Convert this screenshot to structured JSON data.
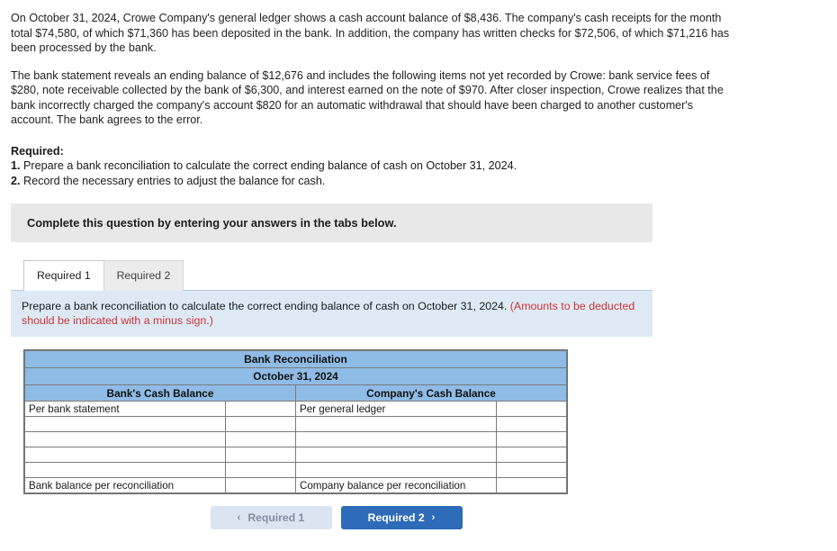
{
  "problem": {
    "paragraph1": "On October 31, 2024, Crowe Company's general ledger shows a cash account balance of $8,436. The company's cash receipts for the month total $74,580, of which $71,360 has been deposited in the bank. In addition, the company has written checks for $72,506, of which $71,216 has been processed by the bank.",
    "paragraph2": "The bank statement reveals an ending balance of $12,676 and includes the following items not yet recorded by Crowe: bank service fees of $280, note receivable collected by the bank of $6,300, and interest earned on the note of $970. After closer inspection, Crowe realizes that the bank incorrectly charged the company's account $820 for an automatic withdrawal that should have been charged to another customer's account. The bank agrees to the error.",
    "required_label": "Required:",
    "req1_num": "1.",
    "req1_text": "Prepare a bank reconciliation to calculate the correct ending balance of cash on October 31, 2024.",
    "req2_num": "2.",
    "req2_text": "Record the necessary entries to adjust the balance for cash."
  },
  "instruction_bar": {
    "text": "Complete this question by entering your answers in the tabs below."
  },
  "tabs": [
    {
      "label": "Required 1",
      "active": true
    },
    {
      "label": "Required 2",
      "active": false
    }
  ],
  "prompt": {
    "main": "Prepare a bank reconciliation to calculate the correct ending balance of cash on October 31, 2024.",
    "note": "(Amounts to be deducted should be indicated with a minus sign.)"
  },
  "recon_table": {
    "title": "Bank Reconciliation",
    "date": "October 31, 2024",
    "col_header_left": "Bank's Cash Balance",
    "col_header_right": "Company's Cash Balance",
    "rows": [
      {
        "left_label": "Per bank statement",
        "left_amount": "",
        "right_label": "Per general ledger",
        "right_amount": ""
      },
      {
        "left_label": "",
        "left_amount": "",
        "right_label": "",
        "right_amount": ""
      },
      {
        "left_label": "",
        "left_amount": "",
        "right_label": "",
        "right_amount": ""
      },
      {
        "left_label": "",
        "left_amount": "",
        "right_label": "",
        "right_amount": ""
      },
      {
        "left_label": "",
        "left_amount": "",
        "right_label": "",
        "right_amount": ""
      },
      {
        "left_label": "Bank balance per reconciliation",
        "left_amount": "",
        "right_label": "Company balance per reconciliation",
        "right_amount": ""
      }
    ]
  },
  "nav": {
    "prev_label": "Required 1",
    "next_label": "Required 2",
    "prev_icon": "chevron-left-icon",
    "next_icon": "chevron-right-icon",
    "prev_chevron": "‹",
    "next_chevron": "›"
  },
  "colors": {
    "table_header_blue": "#8fbce6",
    "prompt_blue": "#ddeaf6",
    "instruction_grey": "#e8e8e8",
    "next_button_blue": "#2e6bb8",
    "prev_button_blue": "#dbe5f1",
    "note_red": "#cc3333"
  }
}
